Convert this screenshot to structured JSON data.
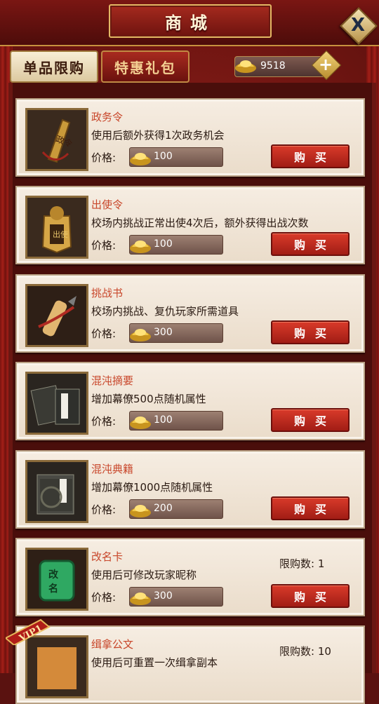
{
  "header": {
    "title": "商城",
    "close_label": "X"
  },
  "tabs": [
    {
      "label": "单品限购",
      "active": true
    },
    {
      "label": "特惠礼包",
      "active": false
    }
  ],
  "currency": {
    "amount": "9518",
    "plus_label": "+",
    "icon": "gold-ingot-icon"
  },
  "labels": {
    "price": "价格:",
    "buy": "购买",
    "limit": "限购数:"
  },
  "items": [
    {
      "name": "政务令",
      "desc": "使用后额外获得1次政务机会",
      "price": "100",
      "icon": "government-token-icon"
    },
    {
      "name": "出使令",
      "desc": "校场内挑战正常出使4次后，额外获得出战次数",
      "price": "100",
      "icon": "envoy-token-icon"
    },
    {
      "name": "挑战书",
      "desc": "校场内挑战、复仇玩家所需道具",
      "price": "300",
      "icon": "challenge-scroll-icon"
    },
    {
      "name": "混沌摘要",
      "desc": "增加幕僚500点随机属性",
      "price": "100",
      "icon": "chaos-summary-book-icon"
    },
    {
      "name": "混沌典籍",
      "desc": "增加幕僚1000点随机属性",
      "price": "200",
      "icon": "chaos-classic-book-icon"
    },
    {
      "name": "改名卡",
      "desc": "使用后可修改玩家昵称",
      "price": "300",
      "limit": "1",
      "icon": "rename-card-icon"
    },
    {
      "name": "缉拿公文",
      "desc": "使用后可重置一次缉拿副本",
      "price": "",
      "limit": "10",
      "icon": "arrest-document-icon"
    }
  ],
  "vip_badge": "VIP1",
  "colors": {
    "accent": "#c8462a",
    "buy": "#c62a1d",
    "panel": "#4a0e0b"
  }
}
